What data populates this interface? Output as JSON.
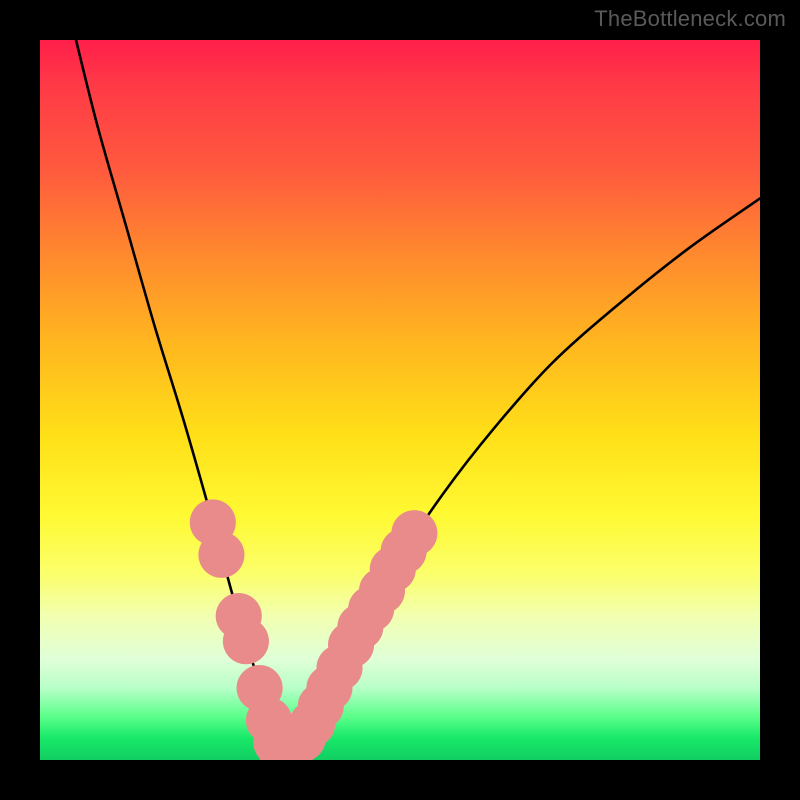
{
  "attribution": "TheBottleneck.com",
  "chart_data": {
    "type": "line",
    "title": "",
    "xlabel": "",
    "ylabel": "",
    "xlim": [
      0,
      100
    ],
    "ylim": [
      0,
      100
    ],
    "background_gradient": [
      "#ff1f4a",
      "#ffe018",
      "#11ce62"
    ],
    "series": [
      {
        "name": "bottleneck-curve",
        "x": [
          5,
          8,
          12,
          16,
          20,
          24,
          27,
          30,
          32,
          33,
          34,
          36,
          38,
          41,
          45,
          50,
          56,
          63,
          71,
          80,
          90,
          100
        ],
        "values": [
          100,
          88,
          74,
          60,
          47,
          33,
          22,
          12,
          5,
          2,
          1,
          2,
          5,
          11,
          19,
          28,
          37,
          46,
          55,
          63,
          71,
          78
        ]
      }
    ],
    "markers": {
      "name": "highlighted-points",
      "color": "#e98b8b",
      "radius": 3.2,
      "points": [
        {
          "x": 24.0,
          "y": 33.0
        },
        {
          "x": 25.2,
          "y": 28.5
        },
        {
          "x": 27.6,
          "y": 20.0
        },
        {
          "x": 28.6,
          "y": 16.5
        },
        {
          "x": 30.5,
          "y": 10.0
        },
        {
          "x": 31.8,
          "y": 5.5
        },
        {
          "x": 32.8,
          "y": 2.5
        },
        {
          "x": 33.5,
          "y": 1.3
        },
        {
          "x": 34.3,
          "y": 1.2
        },
        {
          "x": 35.2,
          "y": 1.8
        },
        {
          "x": 36.5,
          "y": 3.0
        },
        {
          "x": 37.8,
          "y": 5.0
        },
        {
          "x": 39.0,
          "y": 7.5
        },
        {
          "x": 40.2,
          "y": 10.0
        },
        {
          "x": 41.6,
          "y": 12.8
        },
        {
          "x": 43.2,
          "y": 16.0
        },
        {
          "x": 44.5,
          "y": 18.5
        },
        {
          "x": 46.0,
          "y": 21.0
        },
        {
          "x": 47.5,
          "y": 23.5
        },
        {
          "x": 49.0,
          "y": 26.5
        },
        {
          "x": 50.5,
          "y": 29.0
        },
        {
          "x": 52.0,
          "y": 31.5
        }
      ]
    }
  }
}
